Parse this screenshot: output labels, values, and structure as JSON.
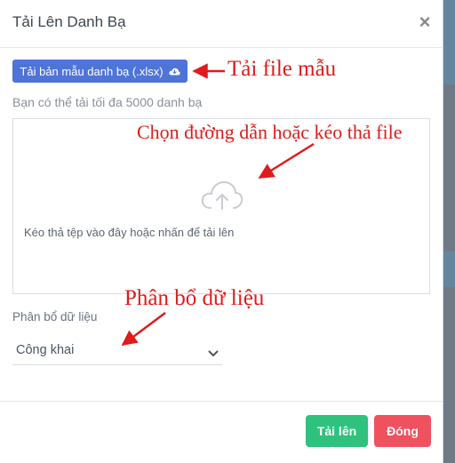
{
  "dialog": {
    "title": "Tải Lên Danh Bạ",
    "close_icon": "close-icon",
    "template_button": {
      "label": "Tải bản mẫu danh bạ (.xlsx)",
      "icon": "cloud-download-icon"
    },
    "limit_text": "Bạn có thể tải tối đa 5000 danh bạ",
    "dropzone": {
      "icon": "cloud-upload-icon",
      "hint": "Kéo thả tệp vào đây hoặc nhấn để tải lên"
    },
    "distribution": {
      "label": "Phân bổ dữ liệu",
      "value": "Công khai",
      "icon": "chevron-down-icon"
    },
    "buttons": {
      "upload": "Tải lên",
      "close": "Đóng"
    }
  },
  "annotations": {
    "template": "Tải file mẫu",
    "dropzone": "Chọn đường dẫn hoặc kéo thả file",
    "distribution": "Phân bổ dữ liệu"
  },
  "colors": {
    "primary": "#4f74d8",
    "success": "#2ec27e",
    "danger": "#f0515f",
    "annotation": "#e01b1b",
    "backdrop": "#7f8a95"
  }
}
